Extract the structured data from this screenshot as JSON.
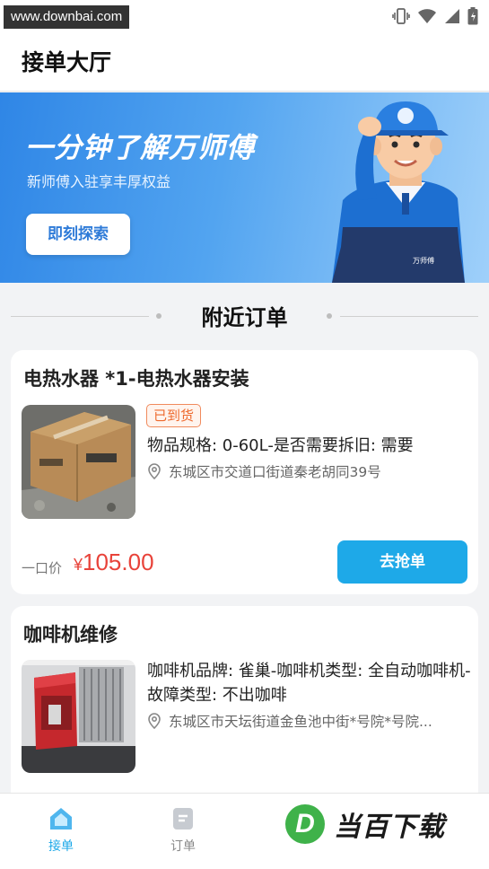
{
  "status": {
    "watermark": "www.downbai.com"
  },
  "header": {
    "title": "接单大厅"
  },
  "banner": {
    "title": "一分钟了解万师傅",
    "subtitle": "新师傅入驻享丰厚权益",
    "button_label": "即刻探索",
    "shirt_logo": "万师傅"
  },
  "section": {
    "title": "附近订单"
  },
  "orders": [
    {
      "title": "电热水器 *1-电热水器安装",
      "badge": "已到货",
      "desc": "物品规格: 0-60L-是否需要拆旧: 需要",
      "address": "东城区市交道口街道秦老胡同39号",
      "price_label": "一口价",
      "currency": "¥",
      "price": "105.00",
      "button_label": "去抢单"
    },
    {
      "title": "咖啡机维修",
      "desc": "咖啡机品牌: 雀巢-咖啡机类型: 全自动咖啡机-故障类型: 不出咖啡",
      "address": "东城区市天坛街道金鱼池中街*号院*号院..."
    }
  ],
  "tabbar": {
    "tabs": [
      {
        "label": "接单",
        "active": true
      },
      {
        "label": "订单",
        "active": false
      }
    ],
    "brand_letter": "D",
    "brand_text": "当百下载"
  },
  "colors": {
    "accent": "#1ea9e8",
    "price": "#e8433a",
    "badge": "#ee6a2e",
    "banner": "#3b8fe8"
  }
}
